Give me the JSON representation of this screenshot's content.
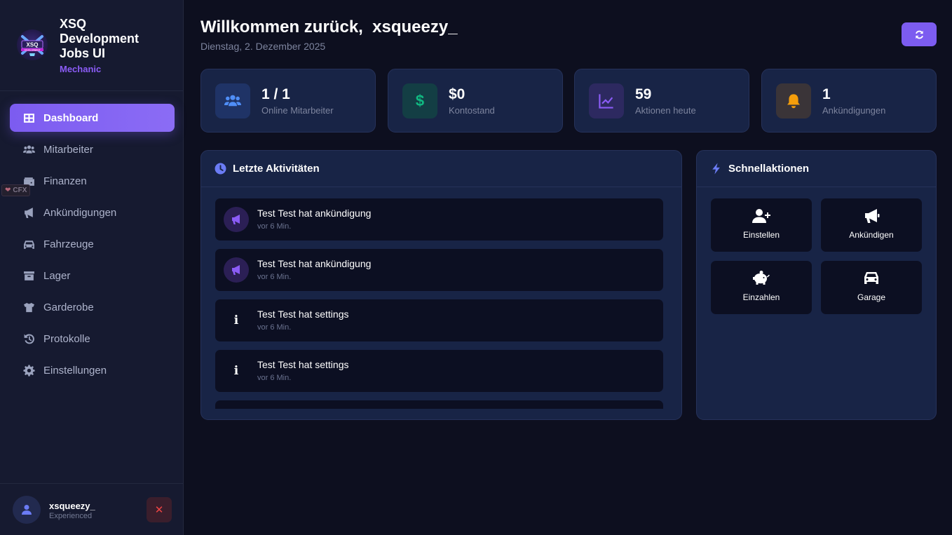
{
  "brand": {
    "logo_text": "XSQ DEVELOPMENT",
    "name": "XSQ Development Jobs UI",
    "role": "Mechanic"
  },
  "sidebar": {
    "items": [
      {
        "label": "Dashboard",
        "icon": "dashboard-grid-icon",
        "active": true
      },
      {
        "label": "Mitarbeiter",
        "icon": "users-icon",
        "active": false
      },
      {
        "label": "Finanzen",
        "icon": "wallet-icon",
        "active": false
      },
      {
        "label": "Ankündigungen",
        "icon": "megaphone-icon",
        "active": false
      },
      {
        "label": "Fahrzeuge",
        "icon": "car-icon",
        "active": false
      },
      {
        "label": "Lager",
        "icon": "box-icon",
        "active": false
      },
      {
        "label": "Garderobe",
        "icon": "shirt-icon",
        "active": false
      },
      {
        "label": "Protokolle",
        "icon": "history-icon",
        "active": false
      },
      {
        "label": "Einstellungen",
        "icon": "gear-icon",
        "active": false
      }
    ]
  },
  "cfx_badge": "CFX",
  "user": {
    "name": "xsqueezy_",
    "rank": "Experienced",
    "logout_symbol": "✕"
  },
  "header": {
    "title": "Willkommen zurück,  xsqueezy_",
    "date": "Dienstag, 2. Dezember 2025"
  },
  "stats": [
    {
      "value": "1 / 1",
      "label": "Online Mitarbeiter",
      "icon": "users-icon",
      "color": "#3b82f6"
    },
    {
      "value": "$0",
      "label": "Kontostand",
      "icon": "dollar-icon",
      "color": "#10b981"
    },
    {
      "value": "59",
      "label": "Aktionen heute",
      "icon": "chart-line-icon",
      "color": "#8b5cf6"
    },
    {
      "value": "1",
      "label": "Ankündigungen",
      "icon": "bell-icon",
      "color": "#f59e0b"
    }
  ],
  "activities": {
    "title": "Letzte Aktivitäten",
    "items": [
      {
        "text": "Test Test hat ankündigung",
        "time": "vor 6 Min.",
        "icon": "megaphone-icon"
      },
      {
        "text": "Test Test hat ankündigung",
        "time": "vor 6 Min.",
        "icon": "megaphone-icon"
      },
      {
        "text": "Test Test hat settings",
        "time": "vor 6 Min.",
        "icon": "info-icon"
      },
      {
        "text": "Test Test hat settings",
        "time": "vor 6 Min.",
        "icon": "info-icon"
      },
      {
        "text": "",
        "time": "",
        "icon": ""
      }
    ]
  },
  "quick_actions": {
    "title": "Schnellaktionen",
    "items": [
      {
        "label": "Einstellen",
        "icon": "user-plus-icon"
      },
      {
        "label": "Ankündigen",
        "icon": "megaphone-icon"
      },
      {
        "label": "Einzahlen",
        "icon": "piggy-bank-icon"
      },
      {
        "label": "Garage",
        "icon": "car-icon"
      }
    ]
  }
}
